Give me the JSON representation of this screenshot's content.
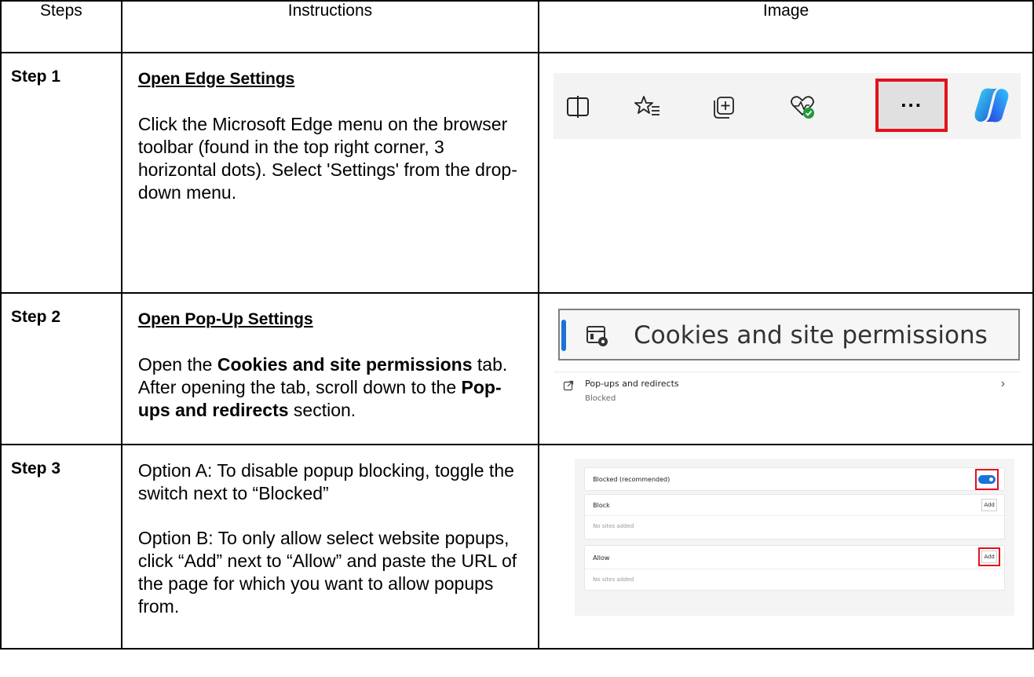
{
  "headers": {
    "steps": "Steps",
    "instructions": "Instructions",
    "image": "Image"
  },
  "steps": [
    {
      "label": "Step 1",
      "heading": "Open Edge Settings",
      "paragraph": "Click the Microsoft Edge menu on the browser toolbar (found in the top right corner, 3 horizontal dots). Select 'Settings' from the drop-down menu.",
      "image": {
        "icons": [
          "split-screen-icon",
          "favorites-icon",
          "collections-icon",
          "browser-essentials-icon",
          "more-options-icon",
          "copilot-icon"
        ],
        "menu_label": "..."
      }
    },
    {
      "label": "Step 2",
      "heading": "Open Pop-Up Settings",
      "p_parts": [
        "Open the ",
        "Cookies and site permissions",
        " tab. After opening the tab, scroll down to the ",
        "Pop-ups and redirects",
        " section."
      ],
      "image": {
        "tab_label": "Cookies and site permissions",
        "row_title": "Pop-ups and redirects",
        "row_status": "Blocked",
        "chevron": "›"
      }
    },
    {
      "label": "Step 3",
      "option_a": "Option A: To disable popup blocking, toggle the switch next to “Blocked”",
      "option_b": "Option B: To only allow select website popups, click “Add” next to “Allow” and paste the URL of the page for which you want to allow popups from.",
      "image": {
        "blocked_label": "Blocked (recommended)",
        "block_label": "Block",
        "allow_label": "Allow",
        "add_label": "Add",
        "empty_label": "No sites added"
      }
    }
  ],
  "colors": {
    "highlight": "#e2111d",
    "accent": "#1a73d8"
  }
}
